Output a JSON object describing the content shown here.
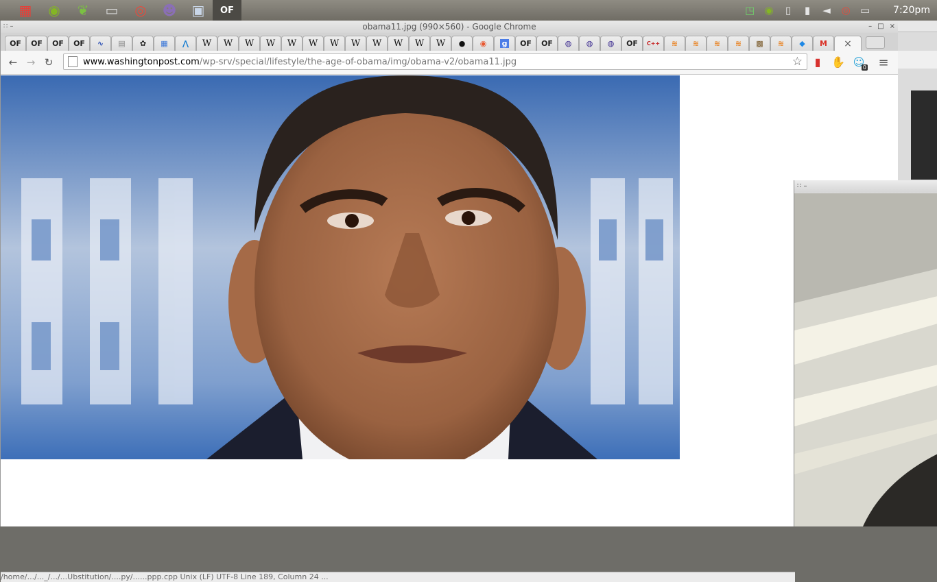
{
  "panel": {
    "dock_items": [
      {
        "name": "apps-menu-icon",
        "glyph": "▦",
        "color": "#e2423a"
      },
      {
        "name": "spotify-icon",
        "glyph": "◉",
        "color": "#84b624"
      },
      {
        "name": "leaf-app-icon",
        "glyph": "❦",
        "color": "#7bc043"
      },
      {
        "name": "files-folder-icon",
        "glyph": "▭",
        "color": "#d8d8d8"
      },
      {
        "name": "chrome-icon",
        "glyph": "◎",
        "color": "#e84a3c"
      },
      {
        "name": "pidgin-icon",
        "glyph": "☻",
        "color": "#8a6fb5"
      },
      {
        "name": "window-app-icon",
        "glyph": "▣",
        "color": "#c9d6e8"
      },
      {
        "name": "openframeworks-icon",
        "glyph": "OF",
        "color": "#ffffff"
      }
    ],
    "tray": [
      {
        "name": "network-messaging-icon",
        "glyph": "◳",
        "color": "#6fd26a"
      },
      {
        "name": "spotify-tray-icon",
        "glyph": "◉",
        "color": "#84b624"
      },
      {
        "name": "clipboard-icon",
        "glyph": "▯",
        "color": "#e6e6e6"
      },
      {
        "name": "signal-icon",
        "glyph": "▮",
        "color": "#e6e6e6"
      },
      {
        "name": "volume-icon",
        "glyph": "◄",
        "color": "#e6e6e6"
      },
      {
        "name": "chrome-tray-icon",
        "glyph": "◎",
        "color": "#e84a3c"
      },
      {
        "name": "battery-icon",
        "glyph": "▭",
        "color": "#e6e6e6"
      }
    ],
    "clock": "7:20pm"
  },
  "window": {
    "title": "obama11.jpg (990×560) - Google Chrome",
    "controls": [
      "–",
      "□",
      "×"
    ]
  },
  "tabs": [
    {
      "icon": "OF",
      "color": "#222"
    },
    {
      "icon": "OF",
      "color": "#222"
    },
    {
      "icon": "OF",
      "color": "#222"
    },
    {
      "icon": "OF",
      "color": "#222"
    },
    {
      "icon": "∿",
      "color": "#3a5bb8"
    },
    {
      "icon": "▤",
      "color": "#888"
    },
    {
      "icon": "✿",
      "color": "#222"
    },
    {
      "icon": "▦",
      "color": "#3c78d8"
    },
    {
      "icon": "⋀",
      "color": "#1a7fd1"
    },
    {
      "icon": "W",
      "color": "#111"
    },
    {
      "icon": "W",
      "color": "#111"
    },
    {
      "icon": "W",
      "color": "#111"
    },
    {
      "icon": "W",
      "color": "#111"
    },
    {
      "icon": "W",
      "color": "#111"
    },
    {
      "icon": "W",
      "color": "#111"
    },
    {
      "icon": "W",
      "color": "#111"
    },
    {
      "icon": "W",
      "color": "#111"
    },
    {
      "icon": "W",
      "color": "#111"
    },
    {
      "icon": "W",
      "color": "#111"
    },
    {
      "icon": "W",
      "color": "#111"
    },
    {
      "icon": "W",
      "color": "#111"
    },
    {
      "icon": "●",
      "color": "#111"
    },
    {
      "icon": "◉",
      "color": "#e8572f"
    },
    {
      "icon": "g",
      "color": "#ffffff",
      "bg": "#4c7de6"
    },
    {
      "icon": "OF",
      "color": "#222"
    },
    {
      "icon": "OF",
      "color": "#222"
    },
    {
      "icon": "◍",
      "color": "#3b2a8f"
    },
    {
      "icon": "◍",
      "color": "#3b2a8f"
    },
    {
      "icon": "◍",
      "color": "#3b2a8f"
    },
    {
      "icon": "OF",
      "color": "#222"
    },
    {
      "icon": "C++",
      "color": "#c62828"
    },
    {
      "icon": "≋",
      "color": "#e8892f"
    },
    {
      "icon": "≋",
      "color": "#e8892f"
    },
    {
      "icon": "≋",
      "color": "#e8892f"
    },
    {
      "icon": "≋",
      "color": "#e8892f"
    },
    {
      "icon": "▩",
      "color": "#7a5a2a"
    },
    {
      "icon": "≋",
      "color": "#e8892f"
    },
    {
      "icon": "◆",
      "color": "#1e88e5"
    },
    {
      "icon": "M",
      "color": "#d93025"
    }
  ],
  "active_tab_close": "×",
  "toolbar": {
    "back": "←",
    "forward": "→",
    "reload": "↻",
    "url_host": "www.washingtonpost.com",
    "url_path": "/wp-srv/special/lifestyle/the-age-of-obama/img/obama-v2/obama11.jpg",
    "star": "☆",
    "extensions": [
      {
        "name": "bookmark-ext-icon",
        "glyph": "▮",
        "color": "#d7322e"
      },
      {
        "name": "adblock-ext-icon",
        "glyph": "✋",
        "color": "#d7322e"
      },
      {
        "name": "ghostery-ext-icon",
        "glyph": "☺",
        "color": "#29a3d8",
        "badge": "0"
      }
    ],
    "menu": "≡"
  },
  "image": {
    "alt": "obama11.jpg"
  },
  "statusbar": {
    "text": "/home/.../..._/.../...Ubstitution/....py/......ppp.cpp    Unix (LF)    UTF-8    Line 189, Column 24    ..."
  },
  "webcam": {
    "grip": "∷  –"
  }
}
